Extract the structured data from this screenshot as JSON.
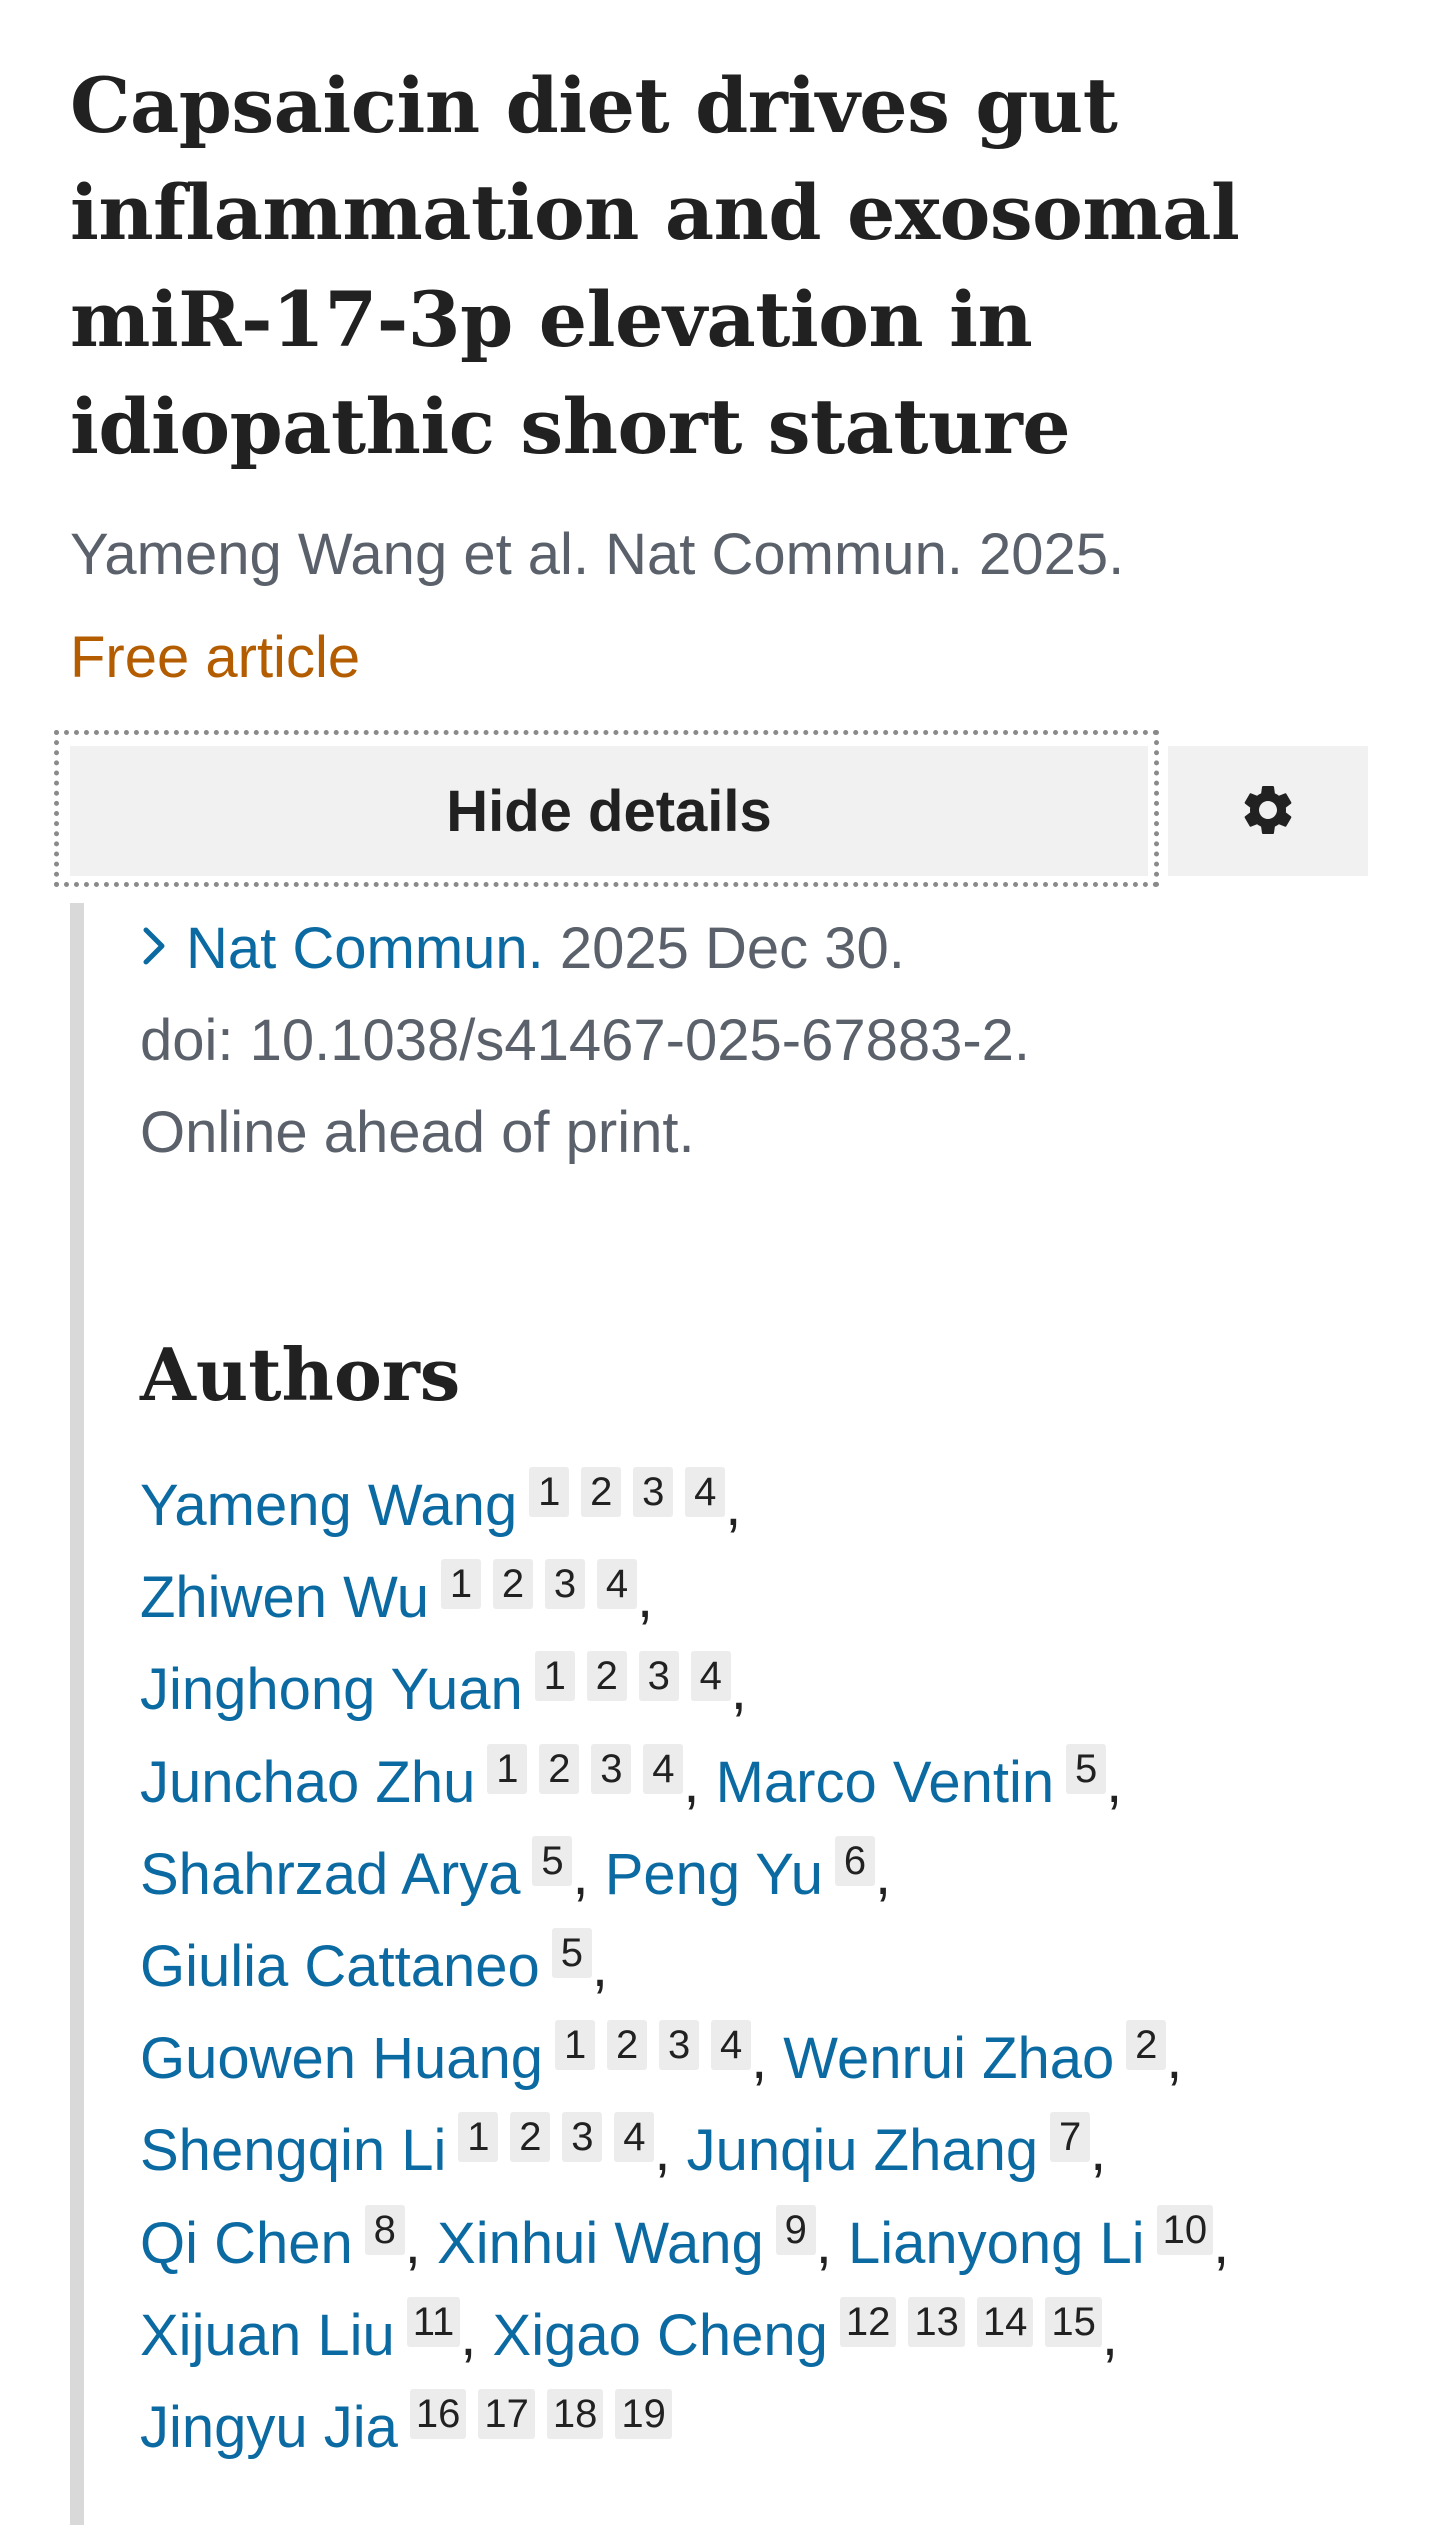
{
  "article": {
    "title": "Capsaicin diet drives gut inflammation and exosomal miR-17-3p elevation in idiopathic short stature",
    "citation": "Yameng Wang et al. Nat Commun. 2025.",
    "free_label": "Free article"
  },
  "toolbar": {
    "hide_details_label": "Hide details",
    "settings_icon": "gear-icon"
  },
  "details": {
    "chevron_icon": "chevron-right-icon",
    "journal": "Nat Commun.",
    "date": " 2025 Dec 30.",
    "doi": "doi: 10.1038/s41467-025-67883-2.",
    "status": "Online ahead of print."
  },
  "authors_heading": "Authors",
  "authors": [
    {
      "name": "Yameng Wang",
      "affs": [
        "1",
        "2",
        "3",
        "4"
      ]
    },
    {
      "name": "Zhiwen Wu",
      "affs": [
        "1",
        "2",
        "3",
        "4"
      ]
    },
    {
      "name": "Jinghong Yuan",
      "affs": [
        "1",
        "2",
        "3",
        "4"
      ]
    },
    {
      "name": "Junchao Zhu",
      "affs": [
        "1",
        "2",
        "3",
        "4"
      ]
    },
    {
      "name": "Marco Ventin",
      "affs": [
        "5"
      ]
    },
    {
      "name": "Shahrzad Arya",
      "affs": [
        "5"
      ]
    },
    {
      "name": "Peng Yu",
      "affs": [
        "6"
      ]
    },
    {
      "name": "Giulia Cattaneo",
      "affs": [
        "5"
      ]
    },
    {
      "name": "Guowen Huang",
      "affs": [
        "1",
        "2",
        "3",
        "4"
      ]
    },
    {
      "name": "Wenrui Zhao",
      "affs": [
        "2"
      ]
    },
    {
      "name": "Shengqin Li",
      "affs": [
        "1",
        "2",
        "3",
        "4"
      ]
    },
    {
      "name": "Junqiu Zhang",
      "affs": [
        "7"
      ]
    },
    {
      "name": "Qi Chen",
      "affs": [
        "8"
      ]
    },
    {
      "name": "Xinhui Wang",
      "affs": [
        "9"
      ]
    },
    {
      "name": "Lianyong Li",
      "affs": [
        "10"
      ]
    },
    {
      "name": "Xijuan Liu",
      "affs": [
        "11"
      ]
    },
    {
      "name": "Xigao Cheng",
      "affs": [
        "12",
        "13",
        "14",
        "15"
      ]
    },
    {
      "name": "Jingyu Jia",
      "affs": [
        "16",
        "17",
        "18",
        "19"
      ]
    }
  ]
}
